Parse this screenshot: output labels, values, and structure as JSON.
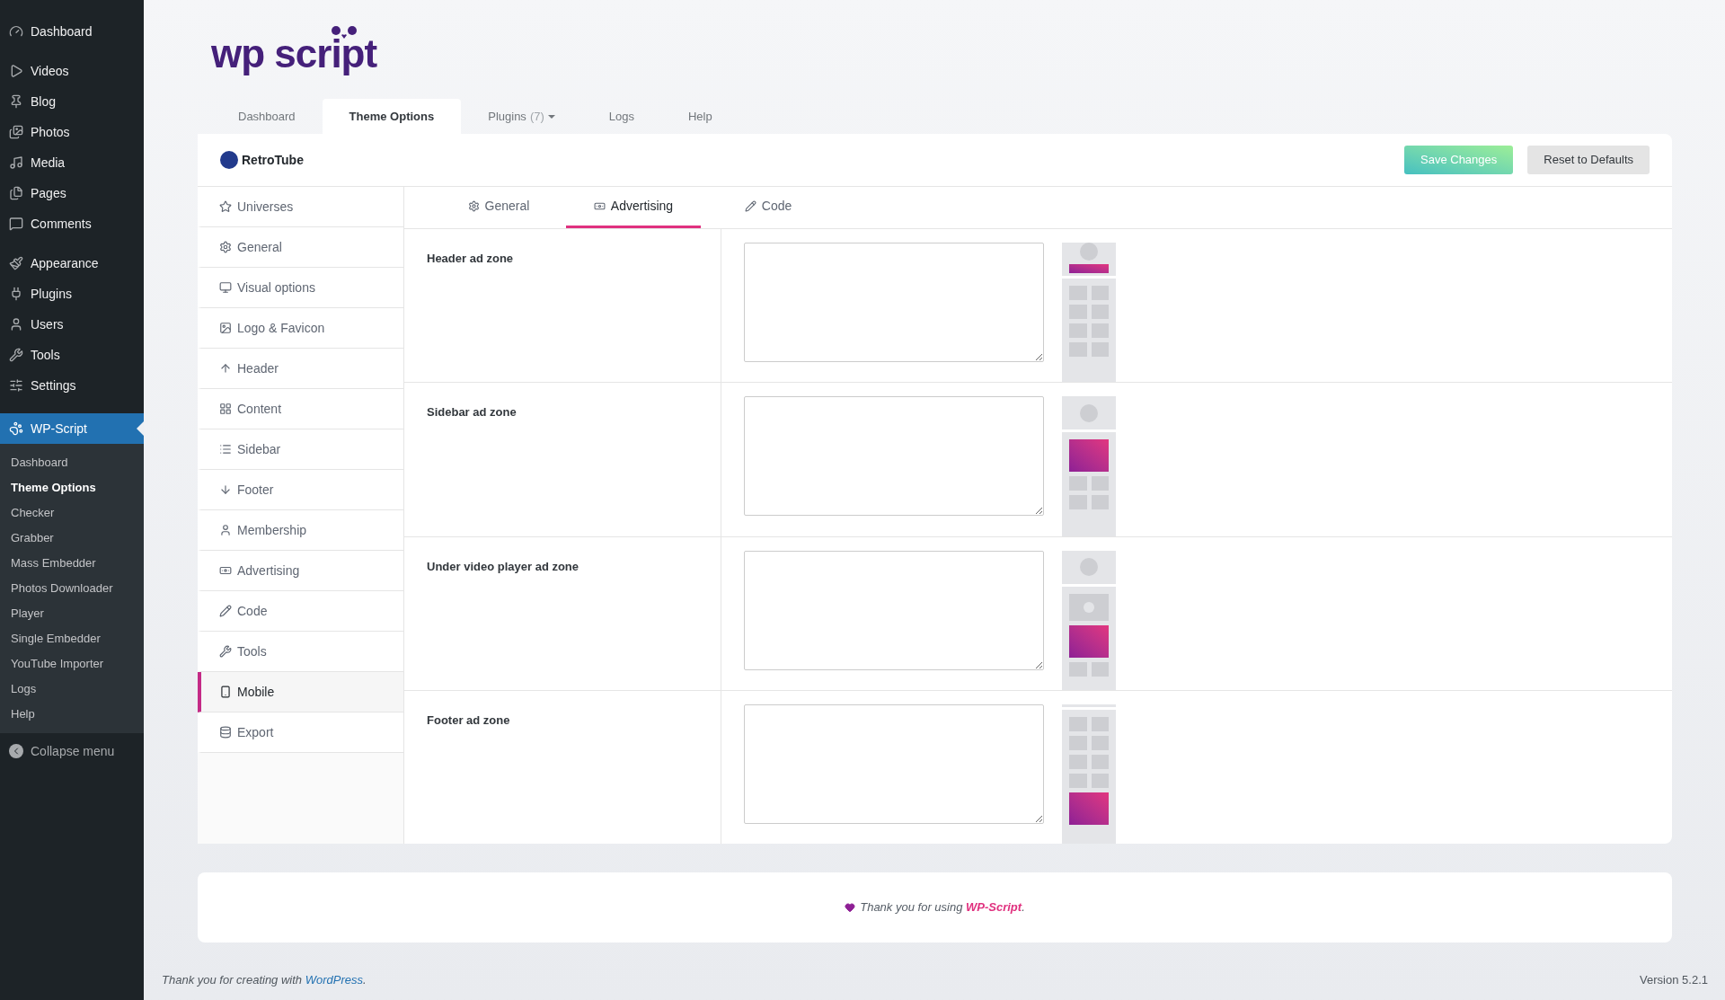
{
  "sidebar": {
    "items": [
      {
        "label": "Dashboard",
        "selected": false
      },
      {
        "label": "Videos",
        "selected": false
      },
      {
        "label": "Blog",
        "selected": false
      },
      {
        "label": "Photos",
        "selected": false
      },
      {
        "label": "Media",
        "selected": false
      },
      {
        "label": "Pages",
        "selected": false
      },
      {
        "label": "Comments",
        "selected": false
      },
      {
        "label": "Appearance",
        "selected": false
      },
      {
        "label": "Plugins",
        "selected": false
      },
      {
        "label": "Users",
        "selected": false
      },
      {
        "label": "Tools",
        "selected": false
      },
      {
        "label": "Settings",
        "selected": false
      },
      {
        "label": "WP-Script",
        "selected": true
      }
    ],
    "submenu": [
      {
        "label": "Dashboard",
        "selected": false
      },
      {
        "label": "Theme Options",
        "selected": true
      },
      {
        "label": "Checker",
        "selected": false
      },
      {
        "label": "Grabber",
        "selected": false
      },
      {
        "label": "Mass Embedder",
        "selected": false
      },
      {
        "label": "Photos Downloader",
        "selected": false
      },
      {
        "label": "Player",
        "selected": false
      },
      {
        "label": "Single Embedder",
        "selected": false
      },
      {
        "label": "YouTube Importer",
        "selected": false
      },
      {
        "label": "Logs",
        "selected": false
      },
      {
        "label": "Help",
        "selected": false
      }
    ],
    "collapse": "Collapse menu"
  },
  "logo": "wp script",
  "tabs": [
    {
      "label": "Dashboard",
      "selected": false
    },
    {
      "label": "Theme Options",
      "selected": true
    },
    {
      "label": "Plugins",
      "count": "(7)",
      "selected": false,
      "dropdown": true
    },
    {
      "label": "Logs",
      "selected": false
    },
    {
      "label": "Help",
      "selected": false
    }
  ],
  "theme": {
    "name": "RetroTube"
  },
  "buttons": {
    "save": "Save Changes",
    "reset": "Reset to Defaults"
  },
  "options_menu": [
    {
      "label": "Universes",
      "selected": false
    },
    {
      "label": "General",
      "selected": false
    },
    {
      "label": "Visual options",
      "selected": false
    },
    {
      "label": "Logo & Favicon",
      "selected": false
    },
    {
      "label": "Header",
      "selected": false
    },
    {
      "label": "Content",
      "selected": false
    },
    {
      "label": "Sidebar",
      "selected": false
    },
    {
      "label": "Footer",
      "selected": false
    },
    {
      "label": "Membership",
      "selected": false
    },
    {
      "label": "Advertising",
      "selected": false
    },
    {
      "label": "Code",
      "selected": false
    },
    {
      "label": "Tools",
      "selected": false
    },
    {
      "label": "Mobile",
      "selected": true
    },
    {
      "label": "Export",
      "selected": false
    }
  ],
  "subtabs": [
    {
      "label": "General",
      "selected": false
    },
    {
      "label": "Advertising",
      "selected": true
    },
    {
      "label": "Code",
      "selected": false
    }
  ],
  "ad_zones": [
    {
      "label": "Header ad zone",
      "kind": "header"
    },
    {
      "label": "Sidebar ad zone",
      "kind": "sidebar"
    },
    {
      "label": "Under video player ad zone",
      "kind": "under_video"
    },
    {
      "label": "Footer ad zone",
      "kind": "footer"
    }
  ],
  "thanks": {
    "text": "Thank you for using",
    "link": "WP-Script",
    "end": "."
  },
  "footer": {
    "text": "Thank you for creating with",
    "link": "WordPress",
    "end": ".",
    "version": "Version 5.2.1"
  }
}
